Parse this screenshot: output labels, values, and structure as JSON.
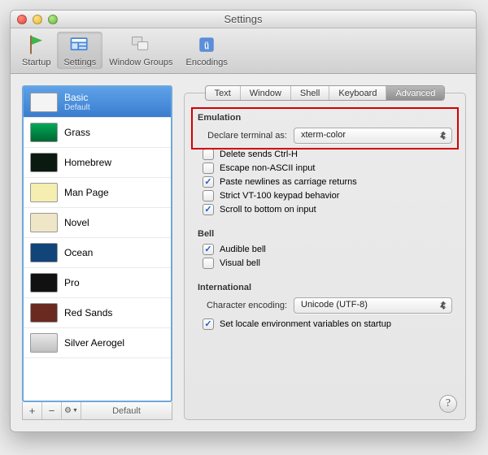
{
  "window": {
    "title": "Settings"
  },
  "toolbar": {
    "items": [
      {
        "label": "Startup"
      },
      {
        "label": "Settings"
      },
      {
        "label": "Window Groups"
      },
      {
        "label": "Encodings"
      }
    ]
  },
  "sidebar": {
    "profiles": [
      {
        "name": "Basic",
        "sub": "Default"
      },
      {
        "name": "Grass"
      },
      {
        "name": "Homebrew"
      },
      {
        "name": "Man Page"
      },
      {
        "name": "Novel"
      },
      {
        "name": "Ocean"
      },
      {
        "name": "Pro"
      },
      {
        "name": "Red Sands"
      },
      {
        "name": "Silver Aerogel"
      }
    ],
    "add": "+",
    "remove": "−",
    "action": "⚙▾",
    "default_button": "Default"
  },
  "tabs": {
    "text": "Text",
    "window": "Window",
    "shell": "Shell",
    "keyboard": "Keyboard",
    "advanced": "Advanced"
  },
  "emulation": {
    "heading": "Emulation",
    "declare_label": "Declare terminal as:",
    "declare_value": "xterm-color",
    "delete_ctrl_h": "Delete sends Ctrl-H",
    "escape_nonascii": "Escape non-ASCII input",
    "paste_newlines": "Paste newlines as carriage returns",
    "strict_vt100": "Strict VT-100 keypad behavior",
    "scroll_bottom": "Scroll to bottom on input"
  },
  "bell": {
    "heading": "Bell",
    "audible": "Audible bell",
    "visual": "Visual bell"
  },
  "international": {
    "heading": "International",
    "encoding_label": "Character encoding:",
    "encoding_value": "Unicode (UTF-8)",
    "set_locale": "Set locale environment variables on startup"
  },
  "help": "?"
}
